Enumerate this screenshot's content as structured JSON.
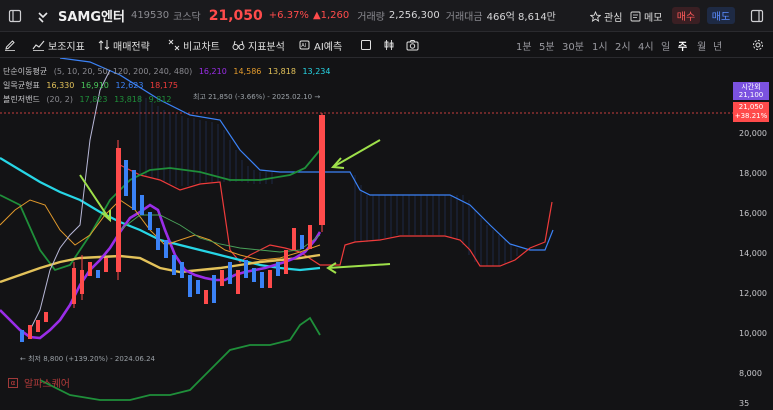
{
  "header": {
    "symbol": "SAMG엔터",
    "code": "419530",
    "market": "코스닥",
    "price": "21,050",
    "change_pct": "+6.37%",
    "change_abs": "▲1,260",
    "volume_label": "거래량",
    "volume": "2,256,300",
    "amount_label": "거래대금",
    "amount": "466억 8,614만",
    "watch_label": "관심",
    "memo_label": "메모",
    "buy_label": "매수",
    "sell_label": "매도"
  },
  "toolbar": {
    "indicators": "보조지표",
    "strategy": "매매전략",
    "compare": "비교차트",
    "analysis": "지표분석",
    "ai": "AI예측",
    "periods": [
      "1분",
      "5분",
      "30분",
      "1시",
      "2시",
      "4시",
      "일",
      "주",
      "월",
      "년"
    ],
    "active_period": "주"
  },
  "legend": {
    "ma_label": "단순이동평균",
    "ma_params": "(5, 10, 20, 50, 120, 200, 240, 480)",
    "ma_values": [
      "16,210",
      "14,586",
      "13,818",
      "13,234"
    ],
    "ichimoku_label": "일목균형표",
    "ichimoku_values": [
      "16,330",
      "16,910",
      "12,623",
      "18,175"
    ],
    "bb_label": "볼린저밴드",
    "bb_params": "(20, 2)",
    "bb_values": [
      "17,823",
      "13,818",
      "9,812"
    ]
  },
  "annotations": {
    "high": "최고 21,850 (-3.66%) - 2025.02.10 →",
    "low": "← 최저 8,800 (+139.20%) - 2024.06.24"
  },
  "yaxis": {
    "ticks": [
      "20,000",
      "18,000",
      "16,000",
      "14,000",
      "12,000",
      "10,000",
      "8,000"
    ],
    "badge_time_label": "시간외",
    "badge_time_value": "21,100",
    "badge_price": "21,050",
    "badge_pct": "+38.21%",
    "bottom_tick": "35"
  },
  "watermark": "알파스퀘어",
  "colors": {
    "up": "#ff4b4b",
    "down": "#3b82f6",
    "accent": "#7b52e0"
  }
}
